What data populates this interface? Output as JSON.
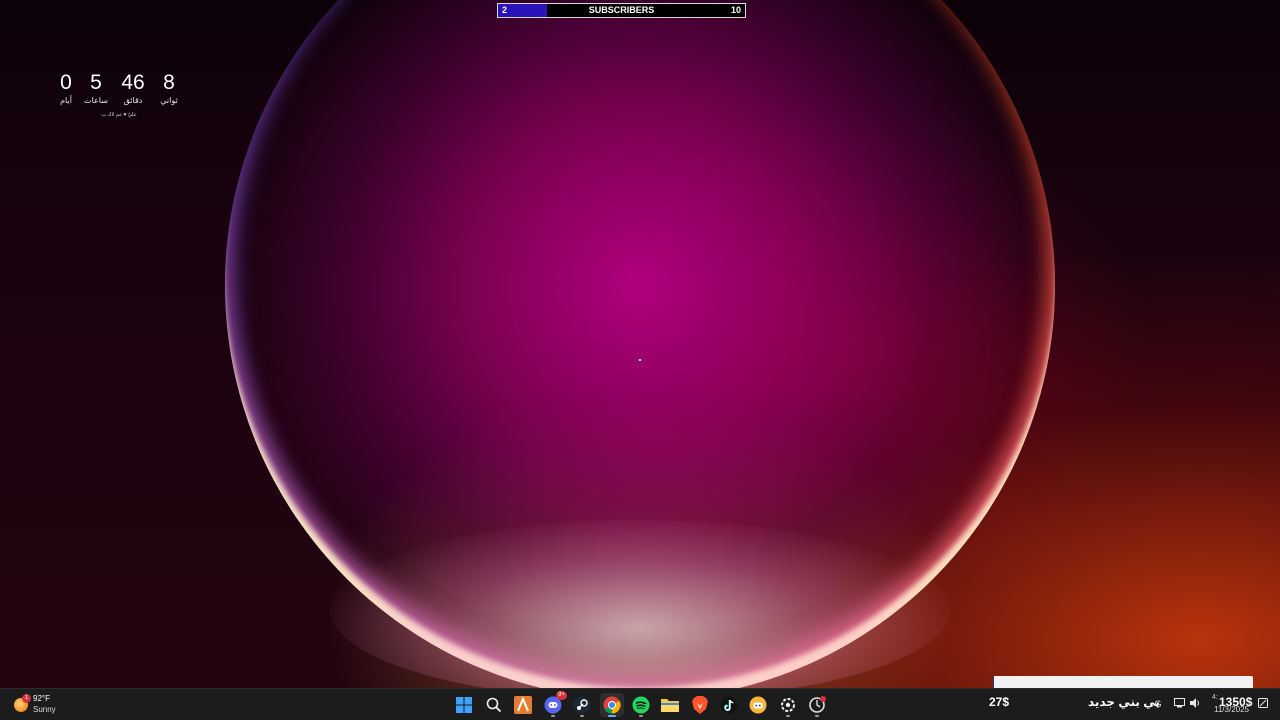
{
  "subscriber_bar": {
    "current": "2",
    "title": "SUBSCRIBERS",
    "goal": "10",
    "progress": 0.2,
    "fill_color": "#2a13b8"
  },
  "countdown": {
    "units": [
      {
        "value": "0",
        "label": "أيام"
      },
      {
        "value": "5",
        "label": "ساعات"
      },
      {
        "value": "46",
        "label": "دقائق"
      },
      {
        "value": "8",
        "label": "ثواني"
      }
    ],
    "note": "عليّ ♥ عم لاك ب"
  },
  "taskbar": {
    "weather": {
      "temp": "92°F",
      "condition": "Sunny",
      "badge": "1"
    },
    "apps": [
      {
        "name": "windows-start-icon",
        "running": false
      },
      {
        "name": "search-icon",
        "running": false
      },
      {
        "name": "a-app-icon",
        "running": false
      },
      {
        "name": "discord-icon",
        "running": true,
        "badge": "9+"
      },
      {
        "name": "steam-icon",
        "running": true
      },
      {
        "name": "chrome-icon",
        "running": true,
        "active": true
      },
      {
        "name": "spotify-icon",
        "running": true
      },
      {
        "name": "file-explorer-icon",
        "running": false
      },
      {
        "name": "brave-icon",
        "running": false
      },
      {
        "name": "tiktok-icon",
        "running": false
      },
      {
        "name": "chat-app-icon",
        "running": false
      },
      {
        "name": "steelseries-icon",
        "running": true
      },
      {
        "name": "app-with-notification-icon",
        "running": true
      }
    ],
    "tray": {
      "donation_amount": "27$",
      "new_baby_text": "بي بني جديد",
      "goal_amount": "1350$",
      "time": "4:",
      "date": "11/3/2025",
      "progress": 0.004
    }
  },
  "colors": {
    "taskbar_bg": "#1c1c1c",
    "subscriber_fill": "#2a13b8",
    "badge_red": "#d6323a"
  }
}
